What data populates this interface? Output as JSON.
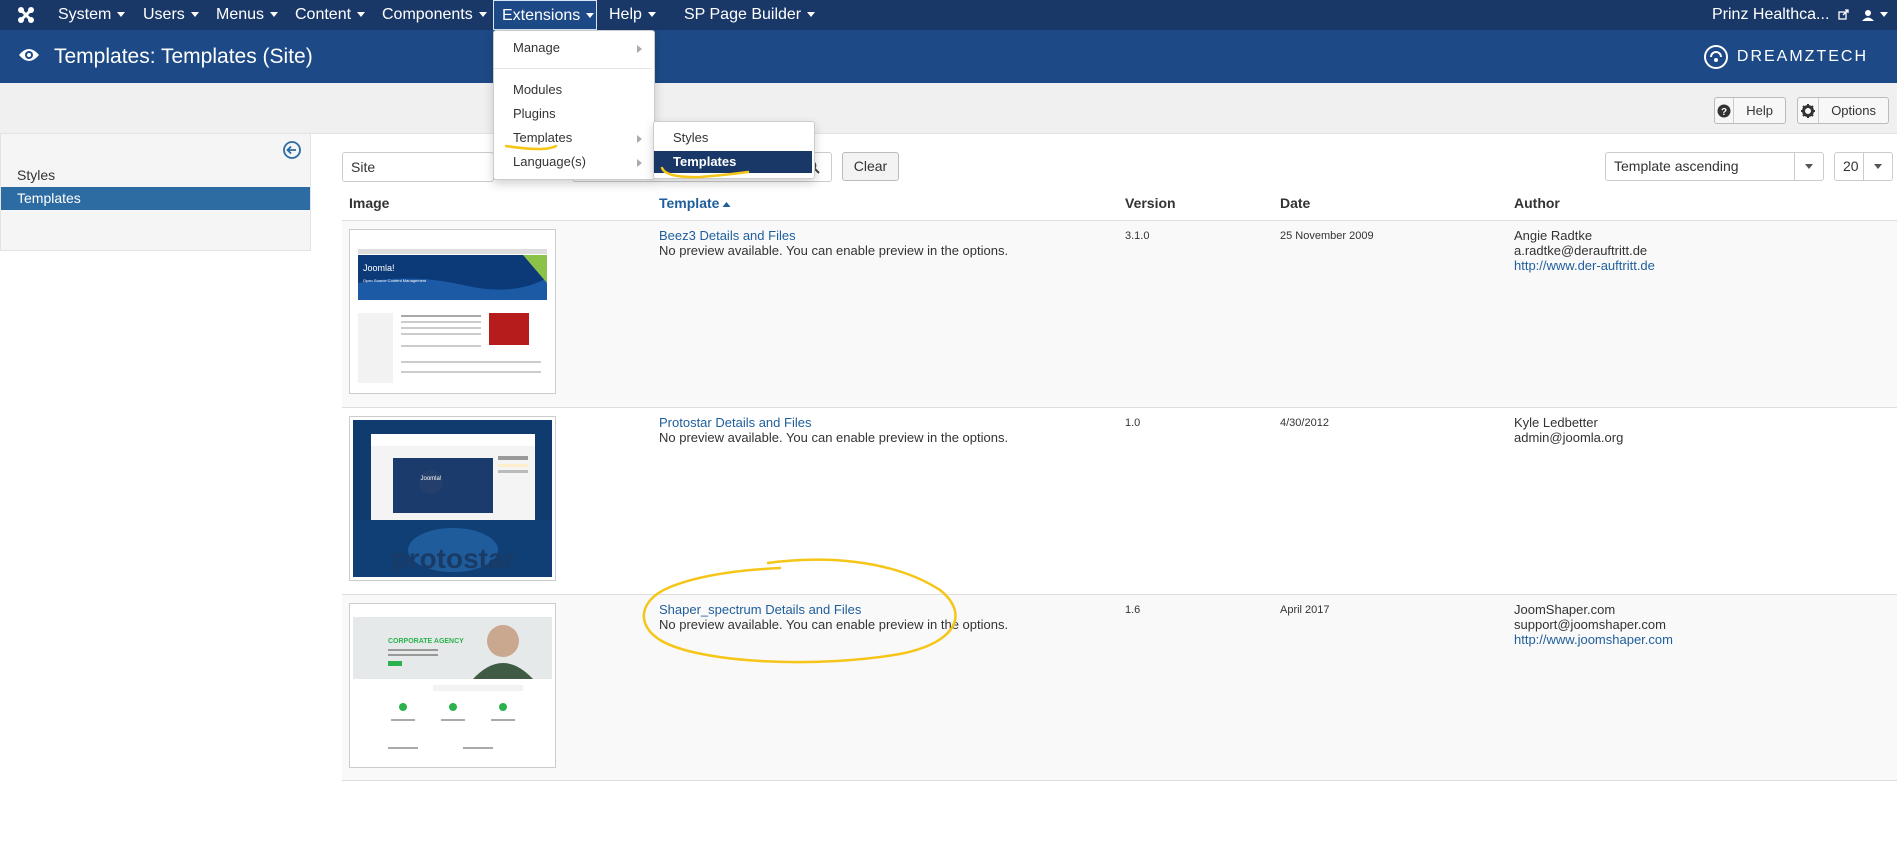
{
  "topnav": {
    "items": [
      {
        "label": "System"
      },
      {
        "label": "Users"
      },
      {
        "label": "Menus"
      },
      {
        "label": "Content"
      },
      {
        "label": "Components"
      },
      {
        "label": "Extensions"
      },
      {
        "label": "Help"
      },
      {
        "label": "SP Page Builder"
      }
    ],
    "site_name": "Prinz Healthca..."
  },
  "header": {
    "title": "Templates: Templates (Site)",
    "brand": "DREAMZTECH"
  },
  "toolbar": {
    "help_label": "Help",
    "options_label": "Options"
  },
  "sidebar": {
    "items": [
      {
        "label": "Styles"
      },
      {
        "label": "Templates"
      }
    ]
  },
  "filters": {
    "client_value": "Site",
    "clear_label": "Clear",
    "sort_value": "Template ascending",
    "limit_value": "20"
  },
  "extensions_menu": {
    "items": [
      {
        "label": "Manage"
      },
      {
        "label": "Modules"
      },
      {
        "label": "Plugins"
      },
      {
        "label": "Templates"
      },
      {
        "label": "Language(s)"
      }
    ],
    "templates_submenu": [
      {
        "label": "Styles"
      },
      {
        "label": "Templates"
      }
    ]
  },
  "table": {
    "headers": {
      "image": "Image",
      "template": "Template",
      "version": "Version",
      "date": "Date",
      "author": "Author"
    },
    "rows": [
      {
        "name": "Beez3 Details and Files",
        "preview": "No preview available. You can enable preview in the options.",
        "version": "3.1.0",
        "date": "25 November 2009",
        "author": "Angie Radtke",
        "email": "a.radtke@derauftritt.de",
        "url": "http://www.der-auftritt.de",
        "thumb_text": "Joomla!",
        "thumb_sub": "Open Source Content Management"
      },
      {
        "name": "Protostar Details and Files",
        "preview": "No preview available. You can enable preview in the options.",
        "version": "1.0",
        "date": "4/30/2012",
        "author": "Kyle Ledbetter",
        "email": "admin@joomla.org",
        "url": "",
        "thumb_text": "protostar",
        "thumb_sub": "Joomla!"
      },
      {
        "name": "Shaper_spectrum Details and Files",
        "preview": "No preview available. You can enable preview in the options.",
        "version": "1.6",
        "date": "April 2017",
        "author": "JoomShaper.com",
        "email": "support@joomshaper.com",
        "url": "http://www.joomshaper.com",
        "thumb_text": "CORPORATE AGENCY",
        "thumb_sub": ""
      }
    ]
  },
  "colors": {
    "navbar": "#1a3867",
    "header": "#1d4a86",
    "link": "#1f5e9c",
    "highlight": "#f5c518"
  }
}
